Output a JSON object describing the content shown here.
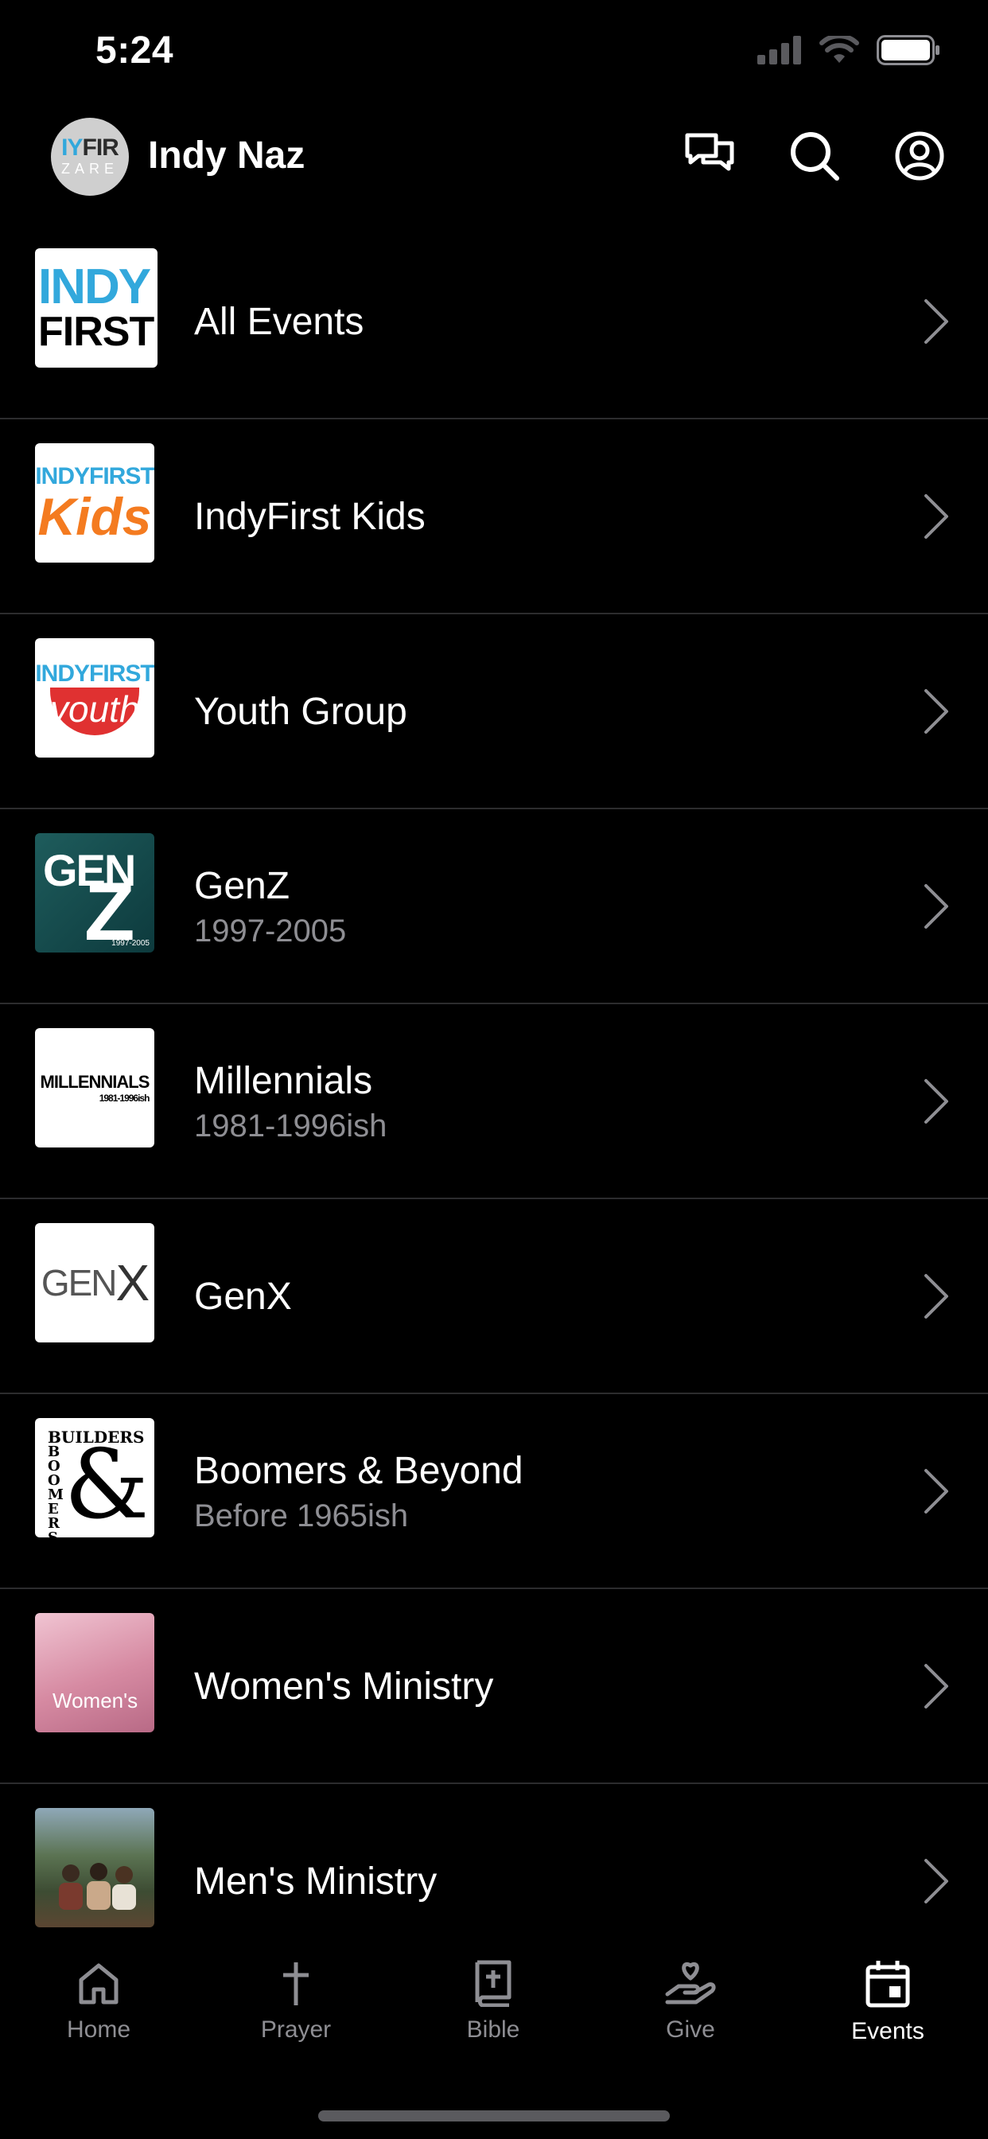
{
  "status": {
    "time": "5:24"
  },
  "header": {
    "title": "Indy Naz",
    "logo_text_top": "IYFIR",
    "logo_text_bottom": "ZARE"
  },
  "list": [
    {
      "title": "All Events",
      "subtitle": "",
      "thumb": "indy-first-logo",
      "thumb_text": [
        "INDY",
        "FIRST"
      ]
    },
    {
      "title": "IndyFirst Kids",
      "subtitle": "",
      "thumb": "indyfirst-kids-logo",
      "thumb_text": [
        "INDYFIRST",
        "Kids"
      ]
    },
    {
      "title": "Youth Group",
      "subtitle": "",
      "thumb": "indyfirst-youth-logo",
      "thumb_text": [
        "INDYFIRST",
        "youth"
      ]
    },
    {
      "title": "GenZ",
      "subtitle": "1997-2005",
      "thumb": "genz-logo",
      "thumb_text": [
        "GEN",
        "Z",
        "1997-2005"
      ]
    },
    {
      "title": "Millennials",
      "subtitle": "1981-1996ish",
      "thumb": "millennials-logo",
      "thumb_text": [
        "MILLENNIALS",
        "1981-1996ish"
      ]
    },
    {
      "title": "GenX",
      "subtitle": "",
      "thumb": "genx-logo",
      "thumb_text": [
        "GEN",
        "X"
      ]
    },
    {
      "title": "Boomers & Beyond",
      "subtitle": "Before 1965ish",
      "thumb": "builders-boomers-logo",
      "thumb_text": [
        "BUILDERS",
        "BOOMERS",
        "&"
      ]
    },
    {
      "title": "Women's Ministry",
      "subtitle": "",
      "thumb": "womens-ministry-photo",
      "thumb_text": [
        "Women's"
      ]
    },
    {
      "title": "Men's Ministry",
      "subtitle": "",
      "thumb": "mens-ministry-photo",
      "thumb_text": []
    }
  ],
  "tabs": [
    {
      "label": "Home",
      "icon": "home-icon",
      "active": false
    },
    {
      "label": "Prayer",
      "icon": "cross-icon",
      "active": false
    },
    {
      "label": "Bible",
      "icon": "bible-icon",
      "active": false
    },
    {
      "label": "Give",
      "icon": "give-hand-heart-icon",
      "active": false
    },
    {
      "label": "Events",
      "icon": "calendar-icon",
      "active": true
    }
  ],
  "colors": {
    "background": "#000000",
    "separator": "#2c2c2e",
    "secondary_text": "#8e8e93",
    "accent_blue": "#32a8dc"
  }
}
